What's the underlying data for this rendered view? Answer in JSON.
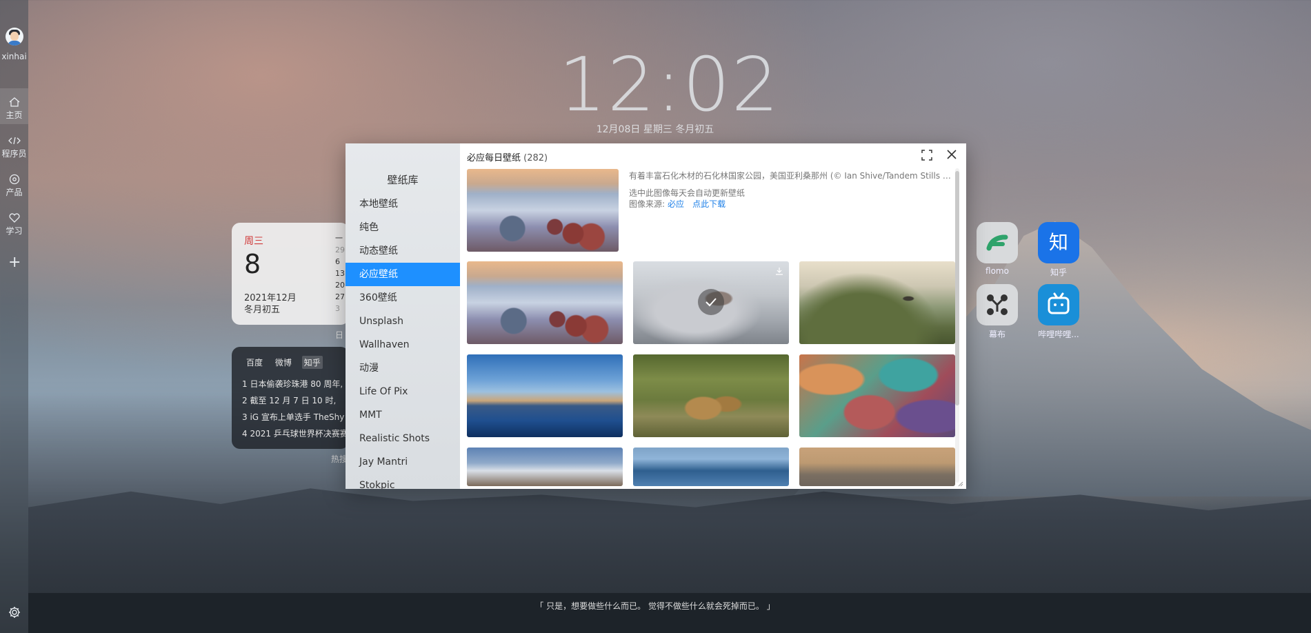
{
  "user": {
    "name": "xinhai"
  },
  "nav": {
    "items": [
      {
        "label": "主页",
        "icon": "home-icon"
      },
      {
        "label": "程序员",
        "icon": "code-icon"
      },
      {
        "label": "产品",
        "icon": "product-icon"
      },
      {
        "label": "学习",
        "icon": "heart-icon"
      }
    ],
    "add_icon": "plus-icon",
    "settings_icon": "gear-icon"
  },
  "clock": {
    "time": "12:02",
    "date": "12月08日 星期三 冬月初五"
  },
  "calendar": {
    "weekday": "周三",
    "day": "8",
    "year_month": "2021年12月",
    "lunar": "冬月初五",
    "column_dates": [
      "一",
      "29",
      "6",
      "13",
      "20",
      "27",
      "3"
    ],
    "caption": "日"
  },
  "hotlist": {
    "tabs": [
      "百度",
      "微博",
      "知乎"
    ],
    "active_tab": "知乎",
    "items": [
      "1 日本偷袭珍珠港 80 周年,",
      "2 截至 12 月 7 日 10 时,",
      "3 iG 宣布上单选手 TheShy",
      "4 2021 乒乓球世界杯决赛赛"
    ],
    "caption": "热搜"
  },
  "apps": [
    {
      "label": "flomo",
      "icon": "flomo-icon",
      "color": "#d8dadc"
    },
    {
      "label": "知乎",
      "icon": "zhihu-icon",
      "color": "#1a73e8"
    },
    {
      "label": "幕布",
      "icon": "mubu-icon",
      "color": "#d8dadc"
    },
    {
      "label": "哔哩哔哩...",
      "icon": "bilibili-icon",
      "color": "#1a8fd8"
    }
  ],
  "quote": "「 只是，想要做些什么而已。 觉得不做些什么就会死掉而已。 」",
  "dialog": {
    "sidebar_title": "壁纸库",
    "sidebar_items": [
      "本地壁纸",
      "纯色",
      "动态壁纸",
      "必应壁纸",
      "360壁纸",
      "Unsplash",
      "Wallhaven",
      "动漫",
      "Life Of Pix",
      "MMT",
      "Realistic Shots",
      "Jay Mantri",
      "Stokpic"
    ],
    "active_item": "必应壁纸",
    "title": "必应每日壁纸",
    "count": "(282)",
    "featured": {
      "description": "有着丰富石化木材的石化林国家公园，美国亚利桑那州 (© Ian Shive/Tandem Stills + Motion)",
      "hint": "选中此图像每天会自动更新壁纸",
      "source_label": "图像来源:",
      "source_link": "必应",
      "download_link": "点此下载"
    },
    "thumbs": [
      {
        "name": "badlands"
      },
      {
        "name": "snow-castle"
      },
      {
        "name": "hill-tower"
      },
      {
        "name": "city-river"
      },
      {
        "name": "cheetahs"
      },
      {
        "name": "autumn-leaves"
      },
      {
        "name": "snow-peaks"
      },
      {
        "name": "icebergs"
      },
      {
        "name": "elephant"
      }
    ],
    "colors": {
      "accent": "#1e90ff",
      "link": "#1e80e8"
    }
  }
}
